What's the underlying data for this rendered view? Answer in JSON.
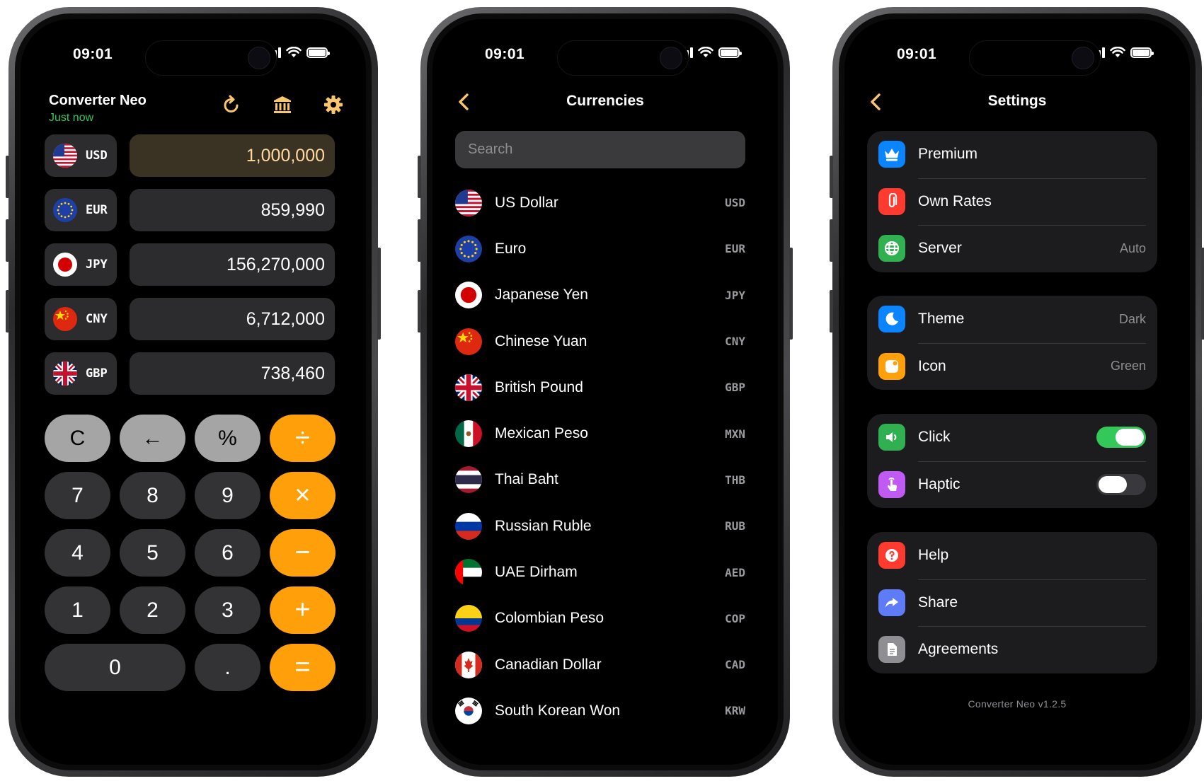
{
  "status": {
    "time": "09:01"
  },
  "converter": {
    "title": "Converter Neo",
    "subtitle": "Just now",
    "rows": [
      {
        "code": "USD",
        "value": "1,000,000",
        "flag": "us-flag-icon"
      },
      {
        "code": "EUR",
        "value": "859,990",
        "flag": "eu-flag-icon"
      },
      {
        "code": "JPY",
        "value": "156,270,000",
        "flag": "jp-flag-icon"
      },
      {
        "code": "CNY",
        "value": "6,712,000",
        "flag": "cn-flag-icon"
      },
      {
        "code": "GBP",
        "value": "738,460",
        "flag": "gb-flag-icon"
      }
    ],
    "keys": {
      "clear": "C",
      "back": "←",
      "percent": "%",
      "divide": "÷",
      "seven": "7",
      "eight": "8",
      "nine": "9",
      "multiply": "×",
      "four": "4",
      "five": "5",
      "six": "6",
      "minus": "−",
      "one": "1",
      "two": "2",
      "three": "3",
      "plus": "+",
      "zero": "0",
      "dot": ".",
      "equals": "="
    }
  },
  "currencies": {
    "title": "Currencies",
    "search_placeholder": "Search",
    "items": [
      {
        "name": "US Dollar",
        "code": "USD"
      },
      {
        "name": "Euro",
        "code": "EUR"
      },
      {
        "name": "Japanese Yen",
        "code": "JPY"
      },
      {
        "name": "Chinese Yuan",
        "code": "CNY"
      },
      {
        "name": "British Pound",
        "code": "GBP"
      },
      {
        "name": "Mexican Peso",
        "code": "MXN"
      },
      {
        "name": "Thai Baht",
        "code": "THB"
      },
      {
        "name": "Russian Ruble",
        "code": "RUB"
      },
      {
        "name": "UAE Dirham",
        "code": "AED"
      },
      {
        "name": "Colombian Peso",
        "code": "COP"
      },
      {
        "name": "Canadian Dollar",
        "code": "CAD"
      },
      {
        "name": "South Korean Won",
        "code": "KRW"
      }
    ]
  },
  "settings": {
    "title": "Settings",
    "premium": "Premium",
    "own_rates": "Own Rates",
    "server": "Server",
    "server_value": "Auto",
    "theme": "Theme",
    "theme_value": "Dark",
    "icon": "Icon",
    "icon_value": "Green",
    "click": "Click",
    "click_on": true,
    "haptic": "Haptic",
    "haptic_on": false,
    "help": "Help",
    "share": "Share",
    "agreements": "Agreements",
    "version": "Converter Neo v1.2.5"
  },
  "colors": {
    "accent": "#ff9f0a",
    "icon_accent": "#f8c66f",
    "update_green": "#34c759",
    "toggle_on": "#34c759"
  }
}
